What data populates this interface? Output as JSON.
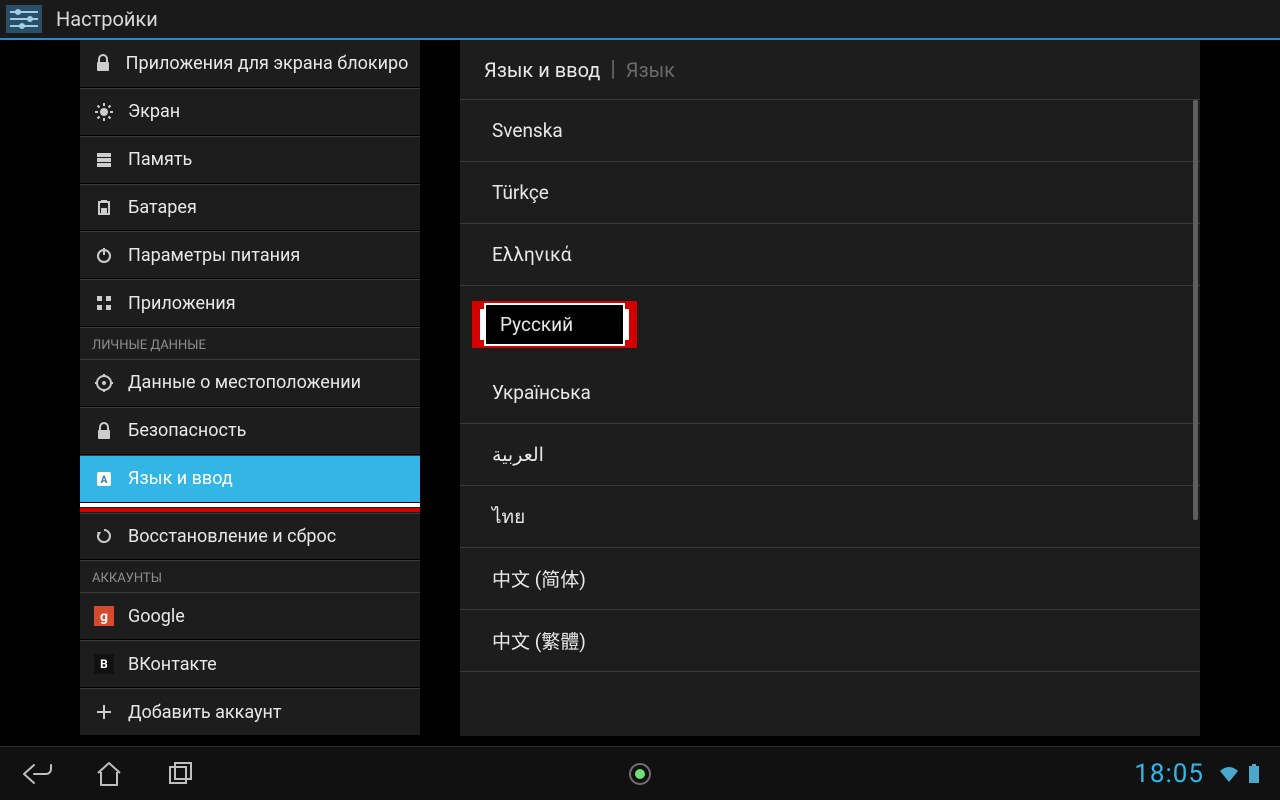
{
  "app_title": "Настройки",
  "sidebar": {
    "items": [
      {
        "icon": "lock",
        "label": "Приложения для экрана блокировки"
      },
      {
        "icon": "brightness",
        "label": "Экран"
      },
      {
        "icon": "storage",
        "label": "Память"
      },
      {
        "icon": "battery",
        "label": "Батарея"
      },
      {
        "icon": "power",
        "label": "Параметры питания"
      },
      {
        "icon": "apps",
        "label": "Приложения"
      }
    ],
    "section_personal": "ЛИЧНЫЕ ДАННЫЕ",
    "items_personal": [
      {
        "icon": "location",
        "label": "Данные о местоположении"
      },
      {
        "icon": "security",
        "label": "Безопасность"
      },
      {
        "icon": "language",
        "label": "Язык и ввод",
        "selected": true
      },
      {
        "icon": "restore",
        "label": "Восстановление и сброс"
      }
    ],
    "section_accounts": "АККАУНТЫ",
    "items_accounts": [
      {
        "icon": "google",
        "label": "Google"
      },
      {
        "icon": "vk",
        "label": "ВКонтакте"
      },
      {
        "icon": "add",
        "label": "Добавить аккаунт"
      }
    ]
  },
  "content": {
    "breadcrumb_main": "Язык и ввод",
    "breadcrumb_sub": "Язык",
    "languages": [
      "Svenska",
      "Türkçe",
      "Ελληνικά",
      "Русский",
      "Українська",
      "العربية",
      "ไทย",
      "中文 (简体)",
      "中文 (繁體)"
    ],
    "highlighted_index": 3
  },
  "navbar": {
    "clock": "18:05"
  },
  "colors": {
    "accent": "#33b5e5",
    "red": "#d40000"
  }
}
